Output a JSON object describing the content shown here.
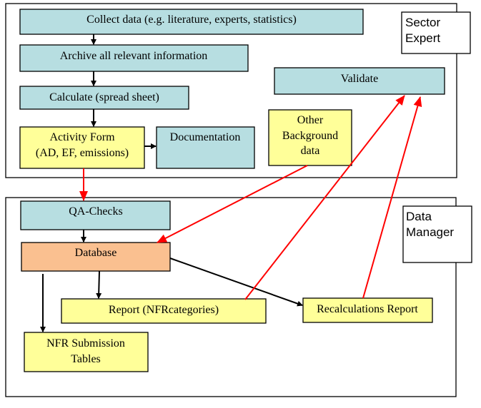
{
  "groups": {
    "sector_expert": [
      "Sector",
      "Expert"
    ],
    "data_manager": [
      "Data",
      "Manager"
    ]
  },
  "nodes": {
    "collect": "Collect data (e.g. literature, experts, statistics)",
    "archive": "Archive all relevant information",
    "calculate": "Calculate (spread sheet)",
    "activity_form": [
      "Activity Form",
      "(AD, EF, emissions)"
    ],
    "documentation": "Documentation",
    "other_background": [
      "Other",
      "Background",
      "data"
    ],
    "validate": "Validate",
    "qa_checks": "QA-Checks",
    "database": "Database",
    "report": "Report (NFRcategories)",
    "recalculations": "Recalculations Report",
    "nfr_tables": [
      "NFR Submission",
      "Tables"
    ]
  },
  "colors": {
    "process_box": "#b7dee1",
    "form_box": "#ffff99",
    "database_box": "#fac090",
    "feedback_arrow": "#ff0000",
    "flow_arrow": "#000000"
  }
}
